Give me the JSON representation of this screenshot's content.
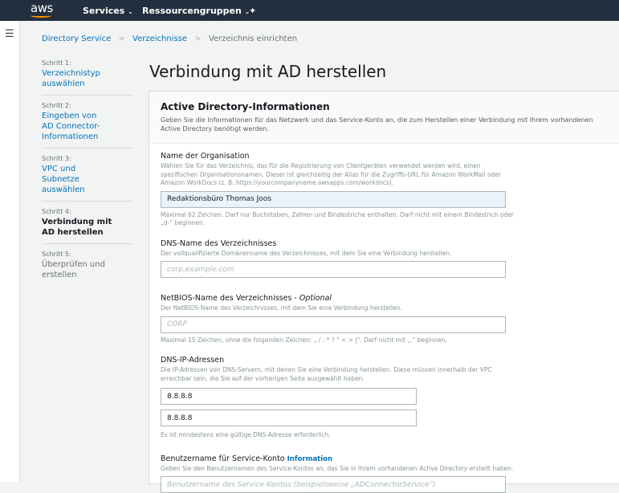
{
  "topbar": {
    "logo": "aws",
    "services": "Services",
    "resource_groups": "Ressourcengruppen"
  },
  "breadcrumb": [
    "Directory Service",
    "Verzeichnisse",
    "Verzeichnis einrichten"
  ],
  "steps": [
    {
      "num": "Schritt 1:",
      "label": "Verzeichnistyp auswählen"
    },
    {
      "num": "Schritt 2:",
      "label": "Eingeben von AD Connector-Informationen"
    },
    {
      "num": "Schritt 3:",
      "label": "VPC und Subnetze auswählen"
    },
    {
      "num": "Schritt 4:",
      "label": "Verbindung mit AD herstellen"
    },
    {
      "num": "Schritt 5:",
      "label": "Überprüfen und erstellen"
    }
  ],
  "page_title": "Verbindung mit AD herstellen",
  "panel": {
    "title": "Active Directory-Informationen",
    "description": "Geben Sie die Informationen für das Netzwerk und das Service-Konto an, die zum Herstellen einer Verbindung mit Ihrem vorhandenen Active Directory benötigt werden.",
    "org": {
      "label": "Name der Organisation",
      "desc": "Wählen Sie für das Verzeichnis, das für die Registrierung von Clientgeräten verwendet werden wird, einen spezifischen Organisationsnamen. Dieser ist gleichzeitig der Alias für die Zugriffs-URL für Amazon WorkMail oder Amazon WorkDocs (z. B. https://yourcompanyname.awsapps.com/workdocs).",
      "value": "Redaktionsbüro Thomas Joos",
      "hint": "Maximal 62 Zeichen. Darf nur Buchstaben, Zahlen und Bindestriche enthalten. Darf nicht mit einem Bindestrich oder „d-“ beginnen."
    },
    "dns_name": {
      "label": "DNS-Name des Verzeichnisses",
      "desc": "Der vollqualifizierte Domänenname des Verzeichnisses, mit dem Sie eine Verbindung herstellen.",
      "placeholder": "corp.example.com"
    },
    "netbios": {
      "label": "NetBIOS-Name des Verzeichnisses - ",
      "optional": "Optional",
      "desc": "Der NetBIOS-Name des Verzeichnisses, mit dem Sie eine Verbindung herstellen.",
      "placeholder": "CORP",
      "hint": "Maximal 15 Zeichen, ohne die folgenden Zeichen: „ / : * ? \" < > |\". Darf nicht mit „.\" beginnen."
    },
    "dns_ip": {
      "label": "DNS-IP-Adressen",
      "desc": "Die IP-Adressen von DNS-Servern, mit denen Sie eine Verbindung herstellen. Diese müssen innerhalb der VPC erreichbar sein, die Sie auf der vorherigen Seite ausgewählt haben.",
      "values": [
        "8.8.8.8",
        "8.8.8.8"
      ],
      "hint": "Es ist mindestens eine gültige DNS-Adresse erforderlich."
    },
    "service_user": {
      "label": "Benutzername für Service-Konto ",
      "info": "Information",
      "desc": "Geben Sie den Benutzernamen des Service-Kontos an, das Sie in Ihrem vorhandenen Active Directory erstellt haben.",
      "placeholder": "Benutzername des Service-Kontos (beispielsweise „ADConnectorService“)"
    }
  }
}
